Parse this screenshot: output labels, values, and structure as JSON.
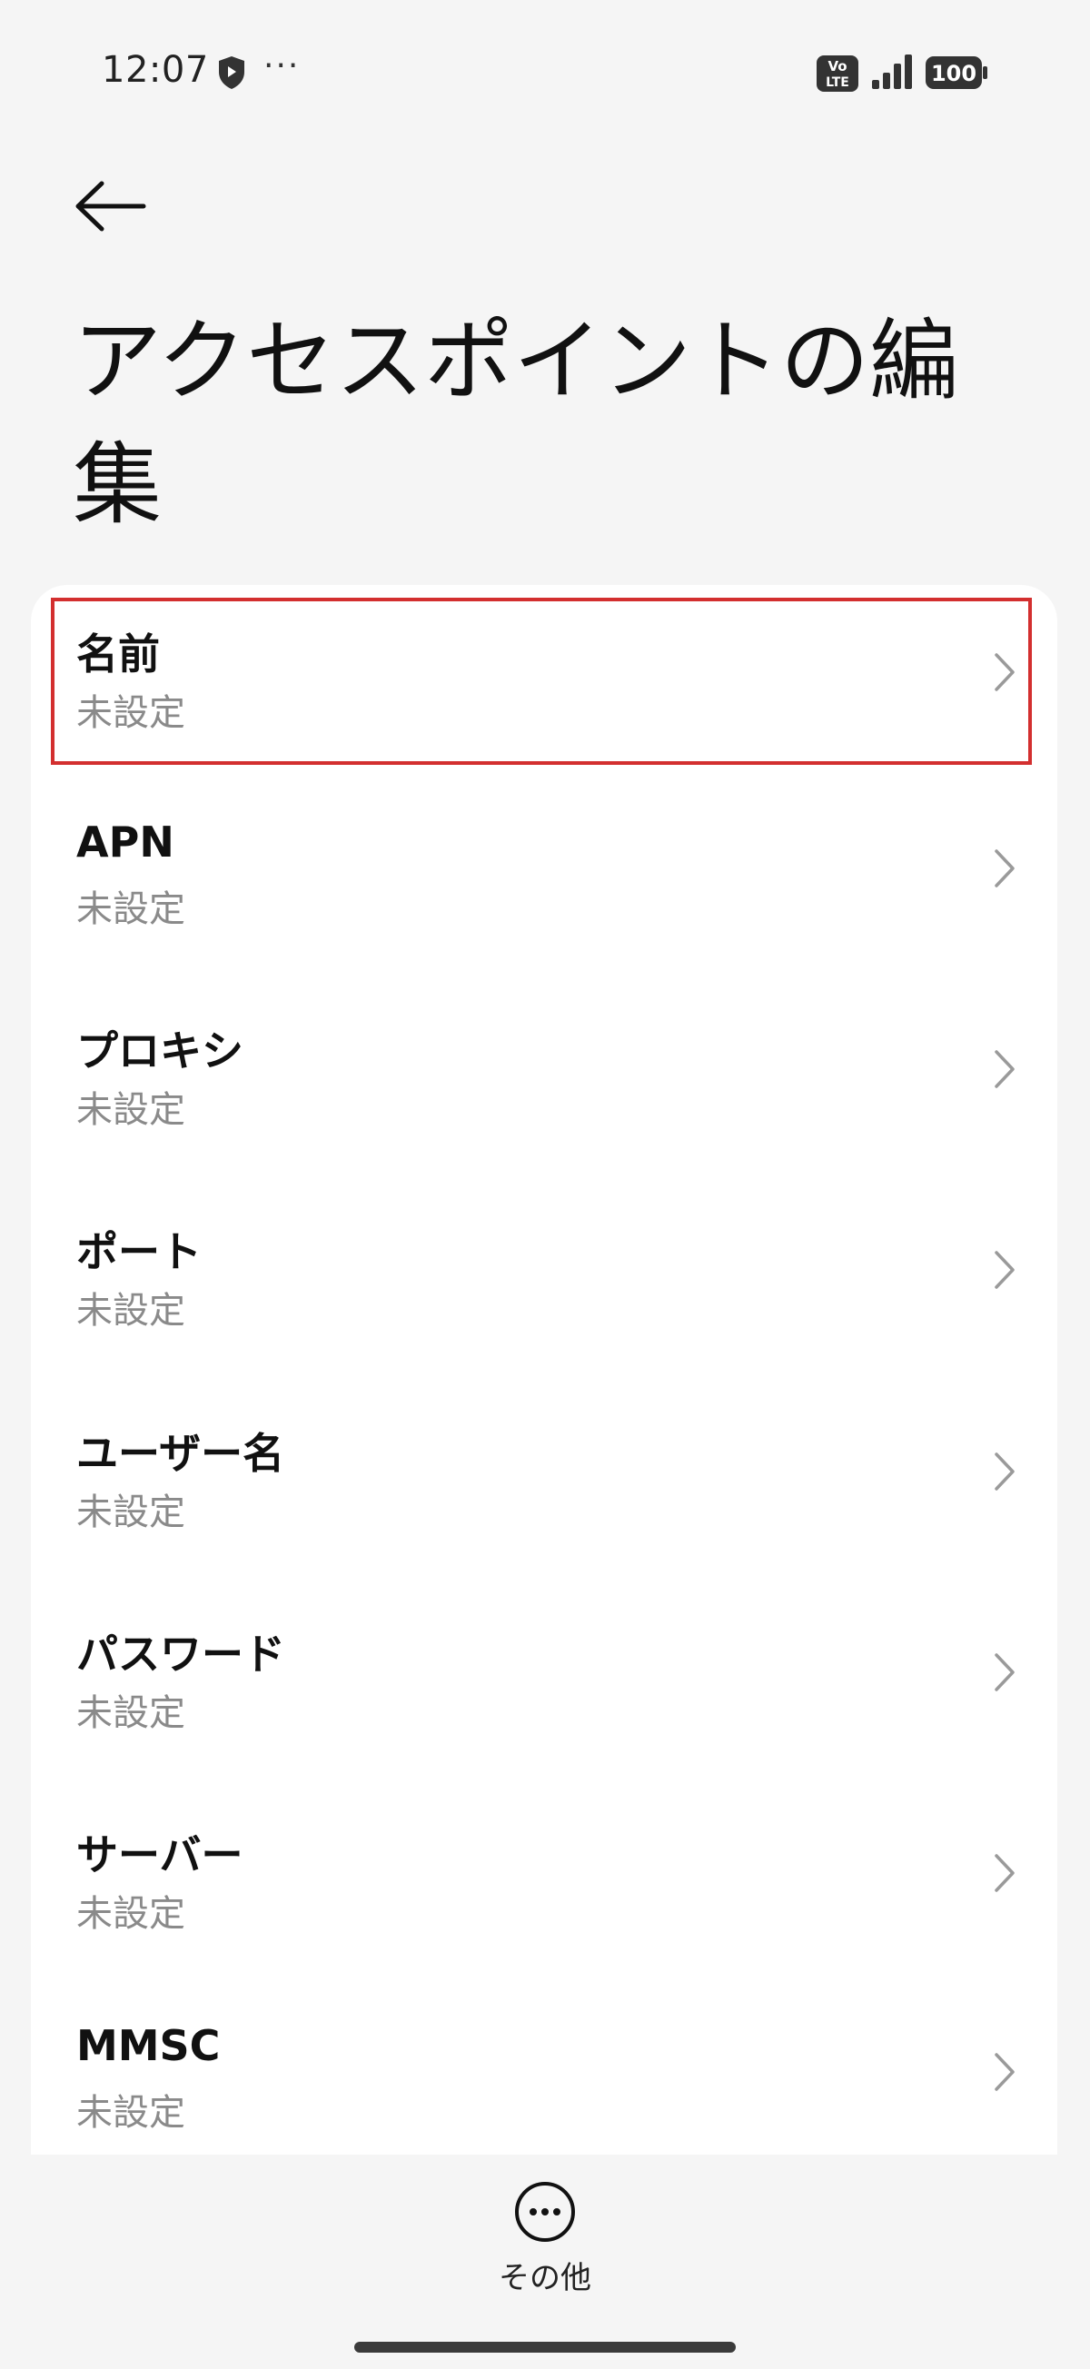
{
  "status_bar": {
    "time": "12:07",
    "volte_top": "Vo",
    "volte_bottom": "LTE",
    "battery": "100",
    "icons": [
      "shield-icon",
      "more-dots-icon",
      "volte-icon",
      "signal-icon",
      "battery-icon"
    ]
  },
  "header": {
    "back_icon": "arrow-left-icon",
    "title": "アクセスポイントの編集"
  },
  "settings": [
    {
      "label": "名前",
      "value": "未設定"
    },
    {
      "label": "APN",
      "value": "未設定"
    },
    {
      "label": "プロキシ",
      "value": "未設定"
    },
    {
      "label": "ポート",
      "value": "未設定"
    },
    {
      "label": "ユーザー名",
      "value": "未設定"
    },
    {
      "label": "パスワード",
      "value": "未設定"
    },
    {
      "label": "サーバー",
      "value": "未設定"
    },
    {
      "label": "MMSC",
      "value": "未設定"
    }
  ],
  "bottom": {
    "more_label": "その他",
    "more_icon": "more-horizontal-circle-icon"
  },
  "colors": {
    "background": "#f5f5f5",
    "card": "#ffffff",
    "highlight": "#d32f2f",
    "secondary_text": "#8a8a8a"
  }
}
